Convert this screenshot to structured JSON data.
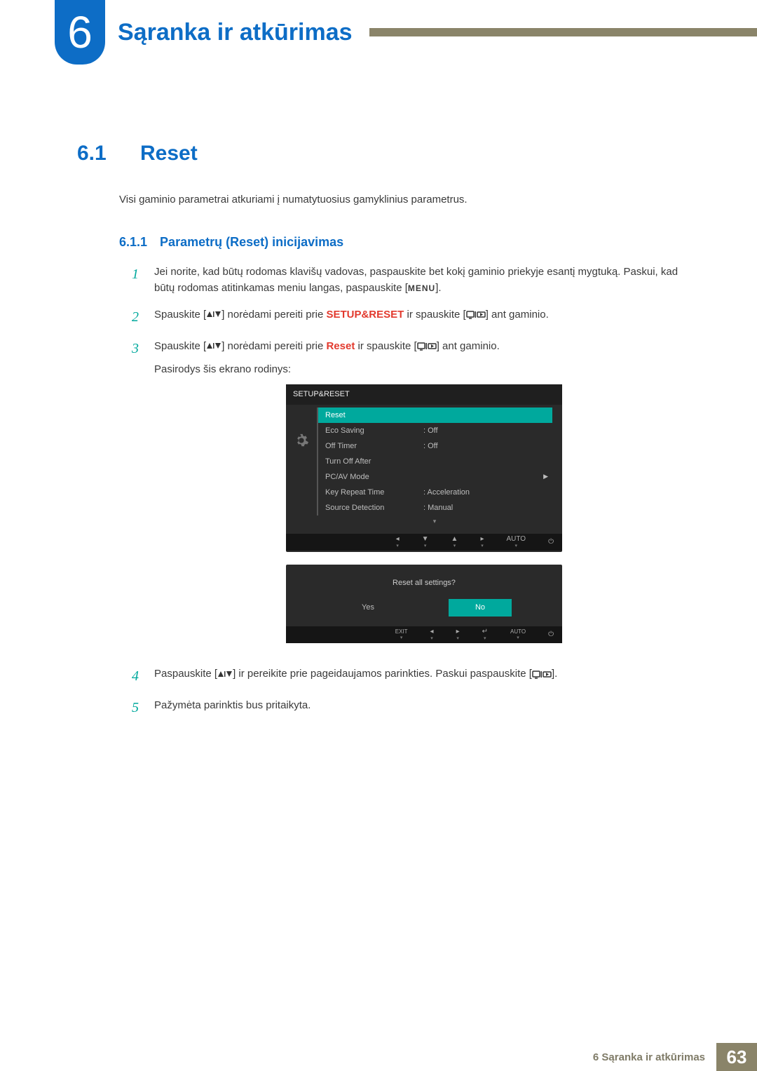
{
  "chapter": {
    "number": "6",
    "title": "Sąranka ir atkūrimas"
  },
  "section": {
    "number": "6.1",
    "title": "Reset"
  },
  "intro": "Visi gaminio parametrai atkuriami į numatytuosius gamyklinius parametrus.",
  "subsection": {
    "number": "6.1.1",
    "title": "Parametrų (Reset) inicijavimas"
  },
  "steps": {
    "s1": {
      "n": "1",
      "a": "Jei norite, kad būtų rodomas klavišų vadovas, paspauskite bet kokį gaminio priekyje esantį mygtuką. Paskui, kad būtų rodomas atitinkamas meniu langas, paspauskite [",
      "menu": "MENU",
      "b": "]."
    },
    "s2": {
      "n": "2",
      "a": "Spauskite [",
      "b": "] norėdami pereiti prie ",
      "kw": "SETUP&RESET",
      "c": " ir spauskite [",
      "d": "] ant gaminio."
    },
    "s3": {
      "n": "3",
      "a": "Spauskite [",
      "b": "] norėdami pereiti prie ",
      "kw": "Reset",
      "c": " ir spauskite [",
      "d": "] ant gaminio.",
      "e": "Pasirodys šis ekrano rodinys:"
    },
    "s4": {
      "n": "4",
      "a": "Paspauskite [",
      "b": "] ir pereikite prie pageidaujamos parinkties. Paskui paspauskite [",
      "c": "]."
    },
    "s5": {
      "n": "5",
      "a": "Pažymėta parinktis bus pritaikyta."
    }
  },
  "osd": {
    "title": "SETUP&RESET",
    "rows": [
      {
        "label": "Reset",
        "val": "",
        "sel": true
      },
      {
        "label": "Eco Saving",
        "val": ": Off",
        "sel": false
      },
      {
        "label": "Off Timer",
        "val": ": Off",
        "sel": false
      },
      {
        "label": "Turn Off After",
        "val": "",
        "sel": false
      },
      {
        "label": "PC/AV Mode",
        "val": "",
        "sel": false,
        "arrow": true
      },
      {
        "label": "Key Repeat Time",
        "val": ": Acceleration",
        "sel": false
      },
      {
        "label": "Source Detection",
        "val": ": Manual",
        "sel": false
      }
    ],
    "btm": {
      "auto": "AUTO"
    }
  },
  "dialog": {
    "q": "Reset all settings?",
    "yes": "Yes",
    "no": "No",
    "exit": "EXIT",
    "auto": "AUTO"
  },
  "footer": {
    "label": "6 Sąranka ir atkūrimas",
    "page": "63"
  }
}
